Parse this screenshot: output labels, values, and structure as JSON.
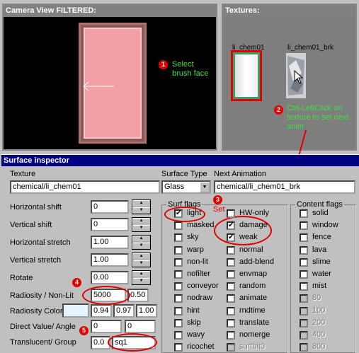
{
  "camera": {
    "title": "Camera View FILTERED:"
  },
  "textures": {
    "title": "Textures:",
    "tex1_label": "li_chem01",
    "tex2_label": "li_chem01_brk"
  },
  "annotations": {
    "n1": "1",
    "n1_text": "Select brush face",
    "n2": "2",
    "n2_text": "Ctrl-LeftClick on texture to set next anim",
    "n3": "3",
    "n3_text": "Set",
    "n4": "4",
    "n5": "5"
  },
  "inspector": {
    "title": "Surface inspector",
    "texture_label": "Texture",
    "texture_value": "chemical/li_chem01",
    "surface_type_label": "Surface Type",
    "surface_type_value": "Glass",
    "next_anim_label": "Next Animation",
    "next_anim_value": "chemical/li_chem01_brk",
    "rows": {
      "hshift_label": "Horizontal shift",
      "hshift_value": "0",
      "vshift_label": "Vertical shift",
      "vshift_value": "0",
      "hstretch_label": "Horizontal stretch",
      "hstretch_value": "1.00",
      "vstretch_label": "Vertical stretch",
      "vstretch_value": "1.00",
      "rotate_label": "Rotate",
      "rotate_value": "0.00",
      "radiosity_label": "Radiosity / Non-Lit",
      "radiosity_value": "5000",
      "nonlit_value": "0.50",
      "rcolor_label": "Radiosity Color",
      "rcolor_r": "0.94",
      "rcolor_g": "0.97",
      "rcolor_b": "1.00",
      "direct_label": "Direct Value/ Angle",
      "direct_value": "0",
      "angle_value": "0",
      "transl_label": "Translucent/ Group",
      "transl_value": "0.0",
      "group_value": "sq1"
    },
    "surf_flags_title": "Surf flags",
    "content_flags_title": "Content flags",
    "surf_col1": [
      "light",
      "masked",
      "sky",
      "warp",
      "non-lit",
      "nofilter",
      "conveyor",
      "nodraw",
      "hint",
      "skip",
      "wavy",
      "ricochet"
    ],
    "surf_col1_checked": [
      true,
      false,
      false,
      false,
      false,
      false,
      false,
      false,
      false,
      false,
      false,
      false
    ],
    "surf_col2": [
      "HW-only",
      "damage",
      "weak",
      "normal",
      "add-blend",
      "envmap",
      "random",
      "animate",
      "rndtime",
      "translate",
      "nomerge",
      "surfbit0"
    ],
    "surf_col2_checked": [
      false,
      true,
      true,
      false,
      false,
      false,
      false,
      false,
      false,
      false,
      false,
      false
    ],
    "content_flags": [
      "solid",
      "window",
      "fence",
      "lava",
      "slime",
      "water",
      "mist",
      "80",
      "100",
      "200",
      "400",
      "800"
    ],
    "content_flags_disabled_from": 7
  }
}
